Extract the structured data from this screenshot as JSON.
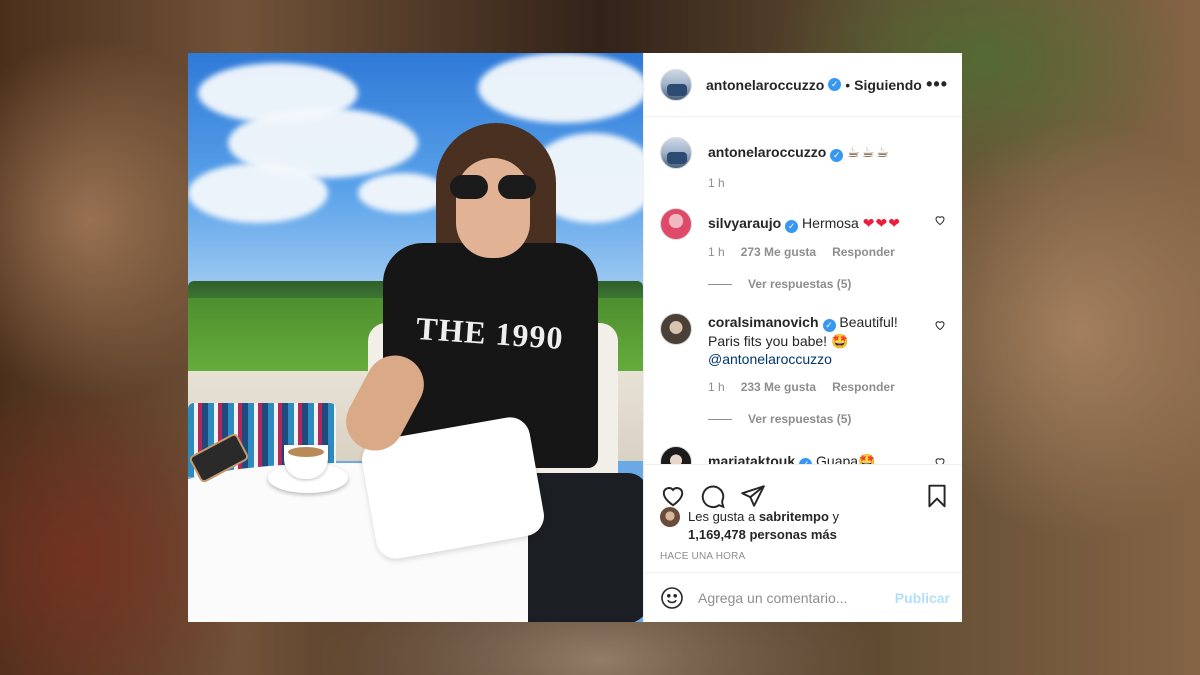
{
  "post": {
    "author": {
      "username": "antonelaroccuzzo",
      "follow_state": "Siguiendo",
      "separator": "•",
      "more_icon": "more-horizontal-icon"
    },
    "photo": {
      "shirt_text": "THE 1990"
    },
    "caption": {
      "username": "antonelaroccuzzo",
      "text": "☕☕☕",
      "time": "1 h"
    },
    "comments": [
      {
        "username": "silvyaraujo",
        "text": "Hermosa ",
        "emoji": "❤❤❤",
        "time": "1 h",
        "likes": "273 Me gusta",
        "reply": "Responder",
        "view_replies": "Ver respuestas (5)"
      },
      {
        "username": "coralsimanovich",
        "text": "Beautiful! Paris fits you babe! 🤩",
        "mention": "@antonelaroccuzzo",
        "time": "1 h",
        "likes": "233 Me gusta",
        "reply": "Responder",
        "view_replies": "Ver respuestas (5)"
      },
      {
        "username": "mariataktouk",
        "text": "Guapa🤩"
      }
    ],
    "likes": {
      "prefix": "Les gusta a ",
      "first_user": "sabritempo",
      "connector": " y",
      "count_text": "1,169,478 personas más"
    },
    "time_ago": "HACE UNA HORA",
    "composer": {
      "placeholder": "Agrega un comentario...",
      "publish_label": "Publicar"
    }
  },
  "colors": {
    "verified": "#3897f0",
    "link": "#00376b",
    "publish_disabled": "#b2dffc",
    "muted": "#8e8e8e"
  }
}
